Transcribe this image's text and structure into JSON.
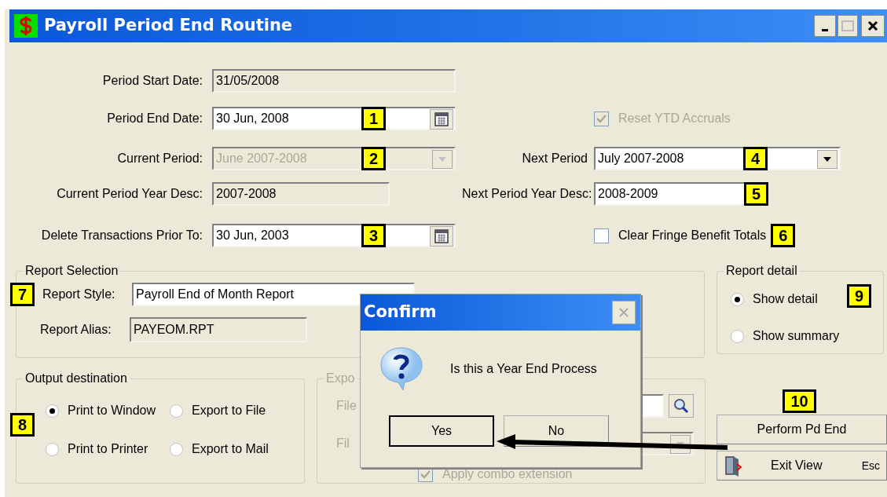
{
  "window": {
    "title": "Payroll Period End Routine"
  },
  "left_fields": [
    {
      "kind": "readonly",
      "label": "Period Start Date:",
      "value": "31/05/2008"
    },
    {
      "kind": "date",
      "label": "Period End Date:",
      "value": "30 Jun, 2008",
      "badge": "1"
    },
    {
      "kind": "combo",
      "label": "Current Period:",
      "value": "June 2007-2008",
      "badge": "2",
      "disabled": true
    },
    {
      "kind": "readonly",
      "label": "Current Period Year Desc:",
      "value": "2007-2008"
    },
    {
      "kind": "date",
      "label": "Delete Transactions Prior To:",
      "value": "30 Jun, 2003",
      "badge": "3"
    }
  ],
  "right_fields": [
    {
      "kind": "checkbox",
      "label": "Reset YTD Accruals",
      "checked": true,
      "disabled": true
    },
    {
      "kind": "combo",
      "label": "Next Period",
      "value": "July 2007-2008",
      "badge": "4",
      "disabled": false
    },
    {
      "kind": "text",
      "label": "Next Period Year Desc:",
      "value": "2008-2009",
      "badge": "5"
    },
    {
      "kind": "checkbox",
      "label": "Clear Fringe Benefit Totals",
      "checked": false,
      "disabled": false,
      "badge": "6"
    }
  ],
  "report_selection": {
    "title": "Report Selection",
    "badge": "7",
    "style_label": "Report Style:",
    "style_value": "Payroll End of Month Report",
    "alias_label": "Report Alias:",
    "alias_value": "PAYEOM.RPT"
  },
  "report_detail": {
    "title": "Report detail",
    "badge": "9",
    "options": [
      {
        "label": "Show detail",
        "selected": true
      },
      {
        "label": "Show summary",
        "selected": false
      }
    ]
  },
  "output_destination": {
    "title": "Output destination",
    "badge": "8",
    "options": [
      {
        "label": "Print to Window",
        "selected": true
      },
      {
        "label": "Export to File",
        "selected": false
      },
      {
        "label": "Print to Printer",
        "selected": false
      },
      {
        "label": "Export to Mail",
        "selected": false
      }
    ]
  },
  "export_group": {
    "title": "Expo",
    "labels": [
      "File",
      "Fil"
    ],
    "apply_combo": {
      "label": "Apply combo extension",
      "checked": true,
      "disabled": true
    }
  },
  "buttons": [
    {
      "kind": "perform",
      "label": "Perform Pd End",
      "badge": "10"
    },
    {
      "kind": "exit",
      "label": "Exit View",
      "shortcut": "Esc"
    }
  ],
  "dialog": {
    "title": "Confirm",
    "message": "Is this a Year End Process",
    "buttons": [
      {
        "label": "Yes",
        "selected": true
      },
      {
        "label": "No",
        "selected": false
      }
    ]
  }
}
